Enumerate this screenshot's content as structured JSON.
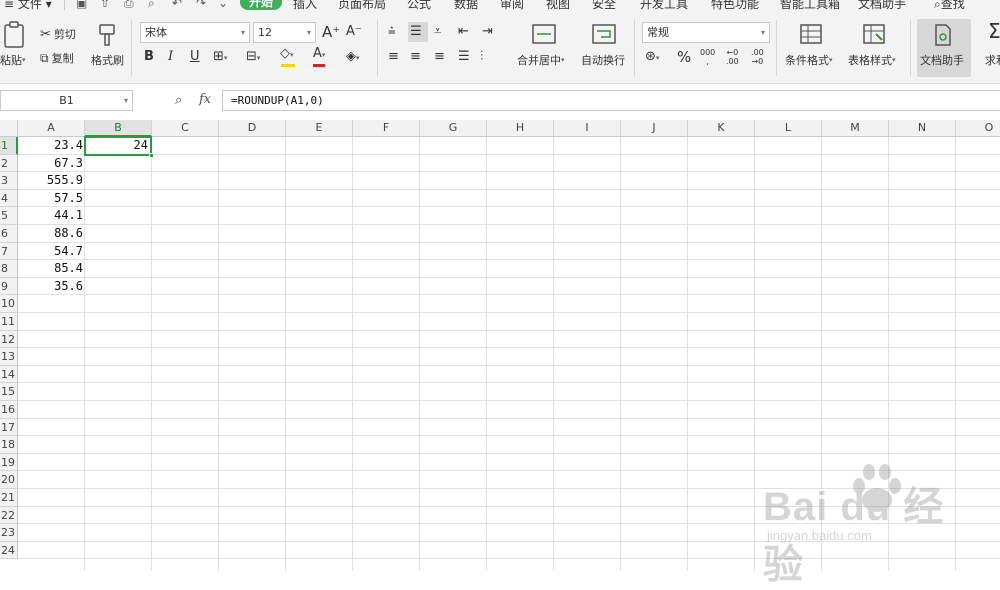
{
  "menubar": {
    "file_label": "文件",
    "tabs": [
      "开始",
      "插入",
      "页面布局",
      "公式",
      "数据",
      "审阅",
      "视图",
      "安全",
      "开发工具",
      "特色功能",
      "智能工具箱",
      "文档助手"
    ],
    "active_tab": "开始",
    "search_label": "查找"
  },
  "ribbon": {
    "paste_label": "粘贴",
    "cut_label": "剪切",
    "copy_label": "复制",
    "format_painter_label": "格式刷",
    "font_name": "宋体",
    "font_size": "12",
    "merge_center_label": "合并居中",
    "wrap_text_label": "自动换行",
    "number_format": "常规",
    "conditional_format_label": "条件格式",
    "table_style_label": "表格样式",
    "doc_assistant_label": "文档助手",
    "sum_label": "求和",
    "accent_color": "#3eae5b",
    "font_color_bar": "#e02020",
    "fill_color_bar": "#f5d400"
  },
  "formula_bar": {
    "cell_ref": "B1",
    "fx_label": "fx",
    "formula": "=ROUNDUP(A1,0)"
  },
  "grid": {
    "columns": [
      "A",
      "B",
      "C",
      "D",
      "E",
      "F",
      "G",
      "H",
      "I",
      "J",
      "K",
      "L",
      "M",
      "N",
      "O"
    ],
    "rows": [
      "1",
      "2",
      "3",
      "4",
      "5",
      "6",
      "7",
      "8",
      "9",
      "10",
      "11",
      "12",
      "13",
      "14",
      "15",
      "16",
      "17",
      "18",
      "19",
      "20",
      "21",
      "22",
      "23",
      "24"
    ],
    "col_a_values": [
      "23.4",
      "67.3",
      "555.9",
      "57.5",
      "44.1",
      "88.6",
      "54.7",
      "85.4",
      "35.6"
    ],
    "b1_value": "24",
    "selected_cell": "B1",
    "selection_color": "#2c9a42"
  },
  "watermark": {
    "brand": "Bai du 经验",
    "url": "jingyan.baidu.com"
  }
}
